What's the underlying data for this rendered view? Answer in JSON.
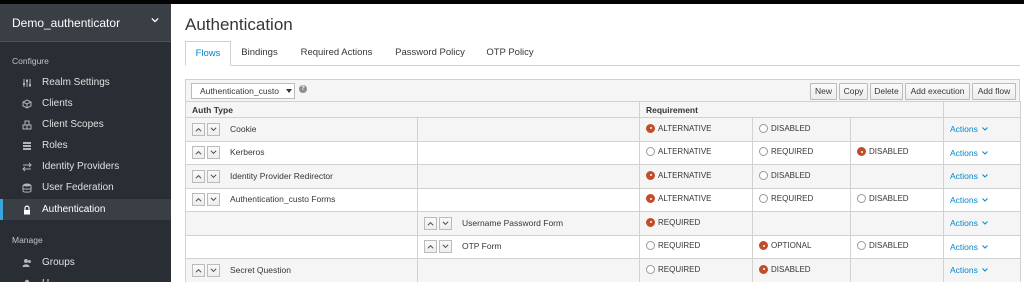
{
  "sidebar": {
    "realm": "Demo_authenticator",
    "configure_label": "Configure",
    "manage_label": "Manage",
    "configure_items": [
      {
        "label": "Realm Settings",
        "icon": "sliders-icon"
      },
      {
        "label": "Clients",
        "icon": "cube-icon"
      },
      {
        "label": "Client Scopes",
        "icon": "cubes-icon"
      },
      {
        "label": "Roles",
        "icon": "tasks-icon"
      },
      {
        "label": "Identity Providers",
        "icon": "exchange-icon"
      },
      {
        "label": "User Federation",
        "icon": "database-icon"
      },
      {
        "label": "Authentication",
        "icon": "lock-icon"
      }
    ],
    "manage_items": [
      {
        "label": "Groups",
        "icon": "users-icon"
      },
      {
        "label": "U",
        "icon": "user-icon"
      }
    ],
    "active": "Authentication"
  },
  "header": {
    "title": "Authentication"
  },
  "tabs": [
    "Flows",
    "Bindings",
    "Required Actions",
    "Password Policy",
    "OTP Policy"
  ],
  "active_tab": "Flows",
  "toolbar": {
    "flow_select": "Authentication_custo",
    "help": "?",
    "buttons": [
      "New",
      "Copy",
      "Delete",
      "Add execution",
      "Add flow"
    ]
  },
  "table": {
    "headers": {
      "auth_type": "Auth Type",
      "requirement": "Requirement"
    },
    "actions_label": "Actions",
    "rows": [
      {
        "name": "Cookie",
        "level": 0,
        "options": [
          {
            "label": "ALTERNATIVE",
            "on": true
          },
          {
            "label": "DISABLED",
            "on": false
          },
          null
        ]
      },
      {
        "name": "Kerberos",
        "level": 0,
        "options": [
          {
            "label": "ALTERNATIVE",
            "on": false
          },
          {
            "label": "REQUIRED",
            "on": false
          },
          {
            "label": "DISABLED",
            "on": true
          }
        ]
      },
      {
        "name": "Identity Provider Redirector",
        "level": 0,
        "options": [
          {
            "label": "ALTERNATIVE",
            "on": true
          },
          {
            "label": "DISABLED",
            "on": false
          },
          null
        ]
      },
      {
        "name": "Authentication_custo Forms",
        "level": 0,
        "options": [
          {
            "label": "ALTERNATIVE",
            "on": true
          },
          {
            "label": "REQUIRED",
            "on": false
          },
          {
            "label": "DISABLED",
            "on": false
          }
        ]
      },
      {
        "name": "Username Password Form",
        "level": 1,
        "options": [
          {
            "label": "REQUIRED",
            "on": true
          },
          null,
          null
        ]
      },
      {
        "name": "OTP Form",
        "level": 1,
        "options": [
          {
            "label": "REQUIRED",
            "on": false
          },
          {
            "label": "OPTIONAL",
            "on": true
          },
          {
            "label": "DISABLED",
            "on": false
          }
        ]
      },
      {
        "name": "Secret Question",
        "level": 0,
        "options": [
          {
            "label": "REQUIRED",
            "on": false
          },
          {
            "label": "DISABLED",
            "on": true
          },
          null
        ]
      }
    ]
  },
  "colors": {
    "sidebar_bg": "#292e34",
    "accent": "#0088ce",
    "selected_radio": "#c24d2a",
    "active_nav_border": "#39a5dc"
  }
}
